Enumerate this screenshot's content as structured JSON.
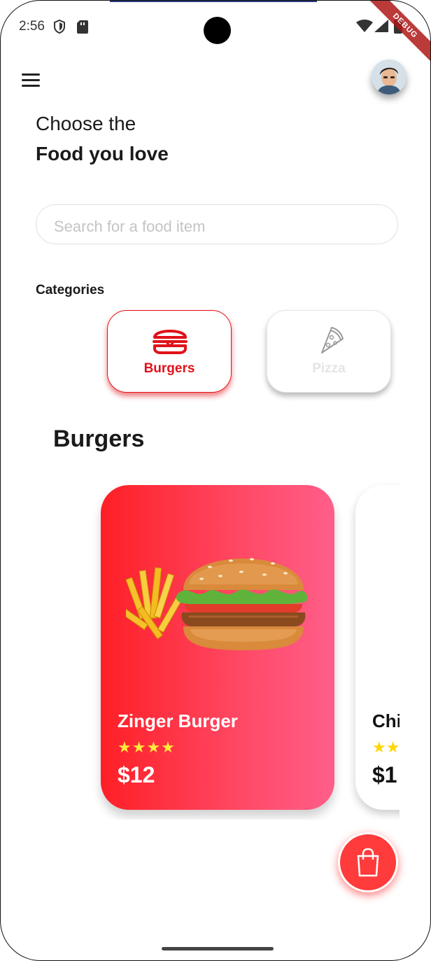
{
  "status_bar": {
    "time": "2:56",
    "icons": [
      "shield-icon",
      "sd-card-icon",
      "wifi-icon",
      "signal-icon",
      "battery-icon"
    ]
  },
  "debug_banner": "DEBUG",
  "header": {
    "menu_icon": "hamburger-menu-icon",
    "avatar": "user-avatar"
  },
  "headline": {
    "line1": "Choose the",
    "line2": "Food you love"
  },
  "search": {
    "placeholder": "Search for a food item"
  },
  "categories": {
    "title": "Categories",
    "items": [
      {
        "label": "Burgers",
        "icon": "burger-icon",
        "selected": true
      },
      {
        "label": "Pizza",
        "icon": "pizza-icon",
        "selected": false
      }
    ]
  },
  "section": {
    "title": "Burgers"
  },
  "food_items": [
    {
      "name": "Zinger Burger",
      "rating": 4,
      "stars": "★★★★",
      "price": "$12"
    },
    {
      "name": "Chi",
      "stars": "★★",
      "price": "$1"
    }
  ],
  "cart_button": {
    "icon": "shopping-bag-icon"
  },
  "colors": {
    "accent": "#e0121a",
    "card_gradient_start": "#fe1f26",
    "card_gradient_end": "#ff5e8a",
    "star": "#ffeb3b",
    "fab": "#ff3b3b"
  }
}
